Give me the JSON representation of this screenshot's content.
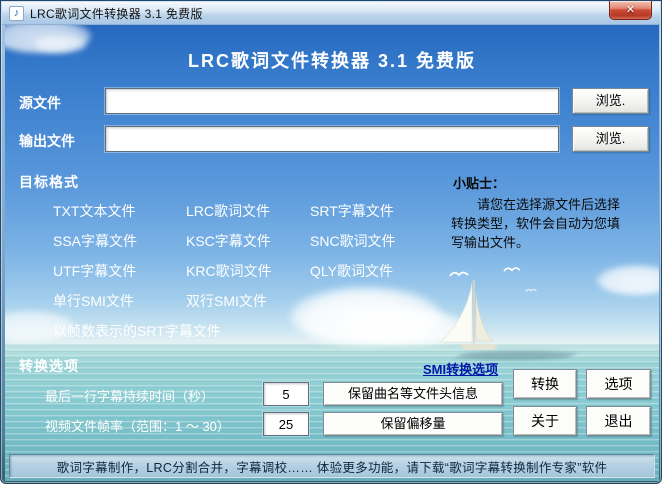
{
  "window": {
    "title": "LRC歌词文件转换器 3.1 免费版",
    "close_glyph": "✕",
    "app_icon_glyph": "♪"
  },
  "header": {
    "title": "LRC歌词文件转换器 3.1 免费版"
  },
  "source": {
    "label": "源文件",
    "value": "",
    "browse_label": "浏览."
  },
  "output": {
    "label": "输出文件",
    "value": "",
    "browse_label": "浏览."
  },
  "formats": {
    "heading": "目标格式",
    "items": [
      "TXT文本文件",
      "LRC歌词文件",
      "SRT字幕文件",
      "SSA字幕文件",
      "KSC字幕文件",
      "SNC歌词文件",
      "UTF字幕文件",
      "KRC歌词文件",
      "QLY歌词文件",
      "单行SMI文件",
      "双行SMI文件",
      "以帧数表示的SRT字幕文件"
    ]
  },
  "tip": {
    "heading": "小贴士：",
    "body": "请您在选择源文件后选择转换类型，软件会自动为您填写输出文件。"
  },
  "options": {
    "heading": "转换选项",
    "smi_link": "SMI转换选项",
    "row1_label": "最后一行字幕持续时间（秒）",
    "row1_value": "5",
    "row1_button": "保留曲名等文件头信息",
    "row2_label": "视频文件帧率（范围：1 ～ 30）",
    "row2_value": "25",
    "row2_button": "保留偏移量"
  },
  "actions": {
    "convert": "转换",
    "options": "选项",
    "about": "关于",
    "exit": "退出"
  },
  "status": {
    "text": "歌词字幕制作，LRC分割合并，字幕调校…… 体验更多功能，请下载“歌词字幕转换制作专家”软件"
  },
  "colors": {
    "sky_top": "#2668bd",
    "water": "#8accd2",
    "titlebar": "#bcd4ec",
    "close_red": "#c44233",
    "link_blue": "#0018a8",
    "text_white": "#ffffff"
  }
}
